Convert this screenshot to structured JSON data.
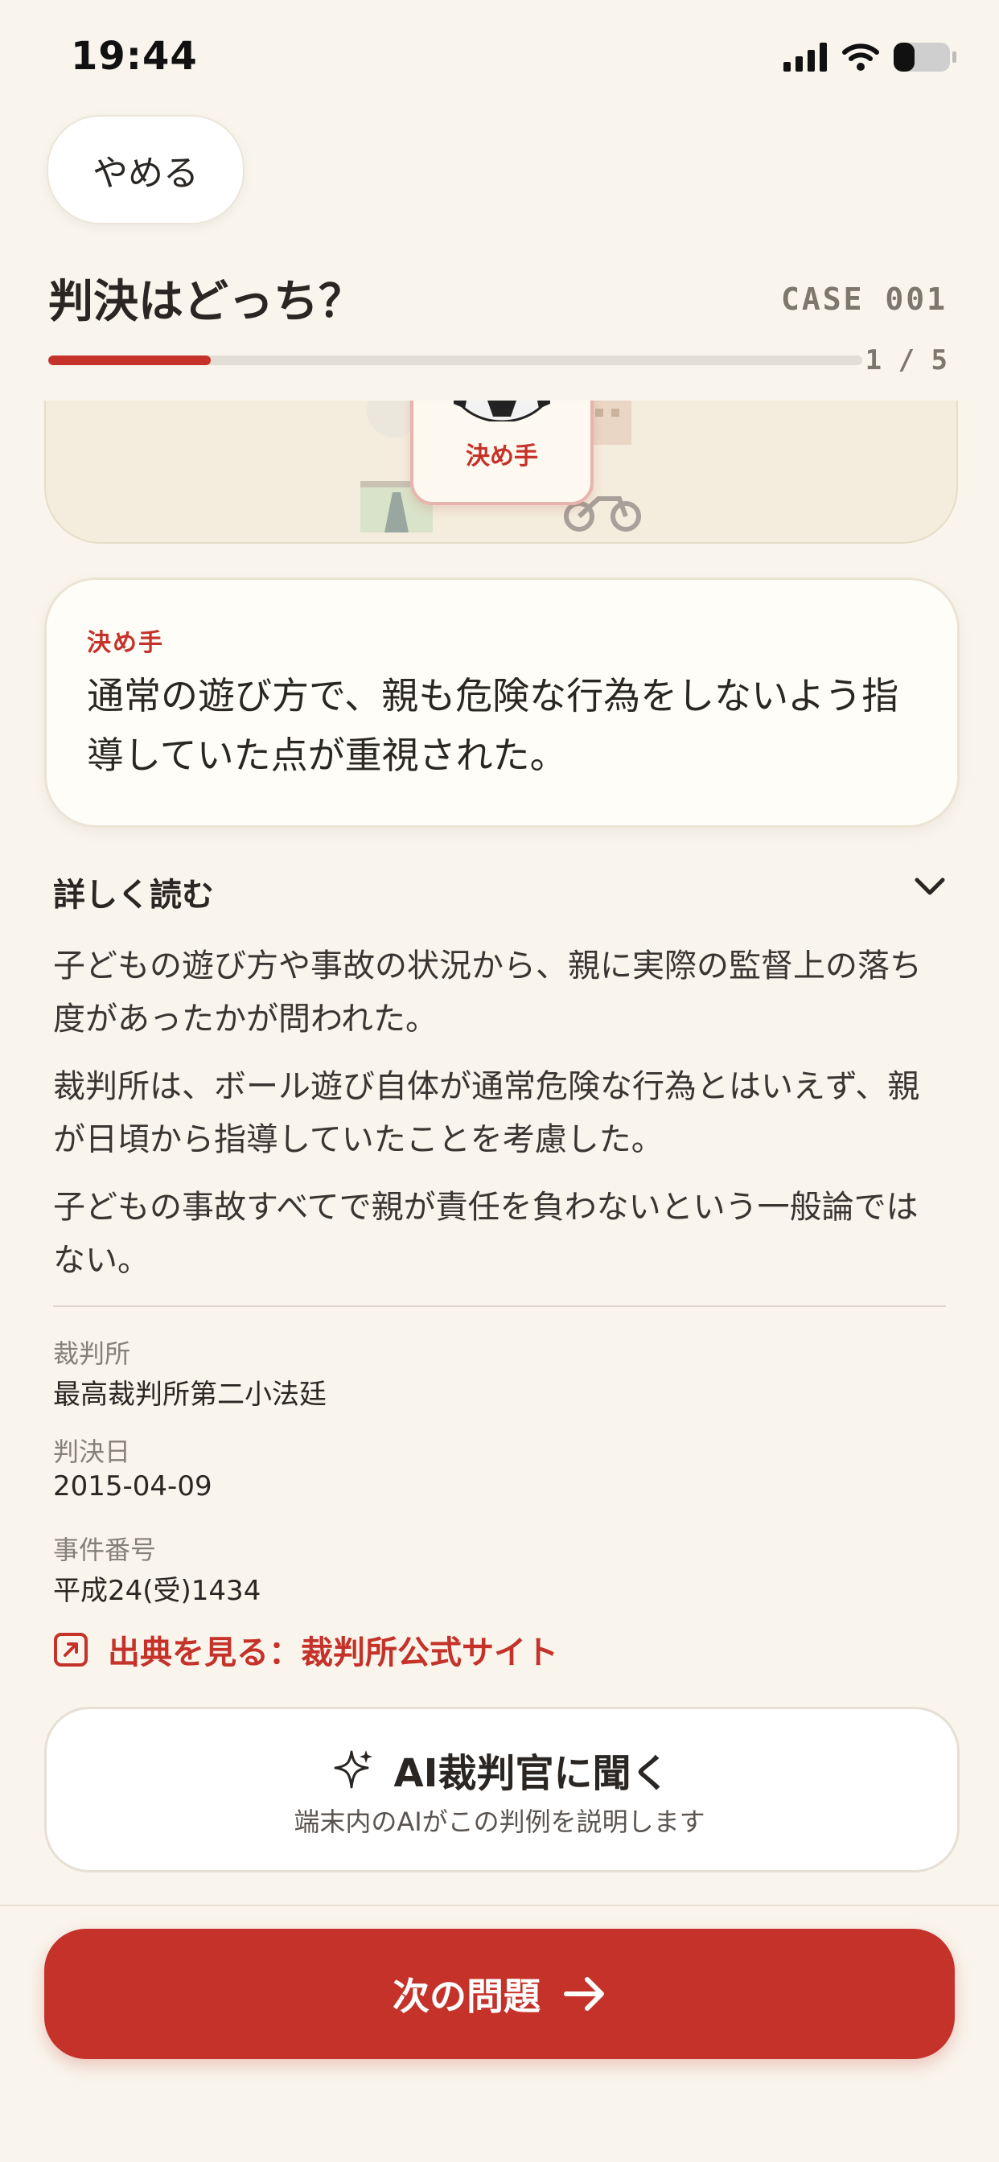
{
  "status_bar": {
    "time": "19:44"
  },
  "header": {
    "quit_label": "やめる",
    "title": "判決はどっち？",
    "case_id": "CASE 001",
    "progress_text": "1 / 5",
    "progress_fraction": 0.2
  },
  "illustration": {
    "tile_label": "決め手"
  },
  "decision": {
    "label": "決め手",
    "text": "通常の遊び方で、親も危険な行為をしないよう指導していた点が重視された。"
  },
  "details": {
    "header": "詳しく読む",
    "paragraphs": [
      "子どもの遊び方や事故の状況から、親に実際の監督上の落ち度があったかが問われた。",
      "裁判所は、ボール遊び自体が通常危険な行為とはいえず、親が日頃から指導していたことを考慮した。",
      "子どもの事故すべてで親が責任を負わないという一般論ではない。"
    ],
    "meta": [
      {
        "label": "裁判所",
        "value": "最高裁判所第二小法廷"
      },
      {
        "label": "判決日",
        "value": "2015-04-09"
      },
      {
        "label": "事件番号",
        "value": "平成24(受)1434"
      }
    ],
    "source_link": "出典を見る：裁判所公式サイト"
  },
  "ai_button": {
    "title": "AI裁判官に聞く",
    "subtitle": "端末内のAIがこの判例を説明します"
  },
  "next_button": {
    "label": "次の問題"
  },
  "colors": {
    "accent": "#c5322a",
    "background": "#f9f5ec"
  }
}
